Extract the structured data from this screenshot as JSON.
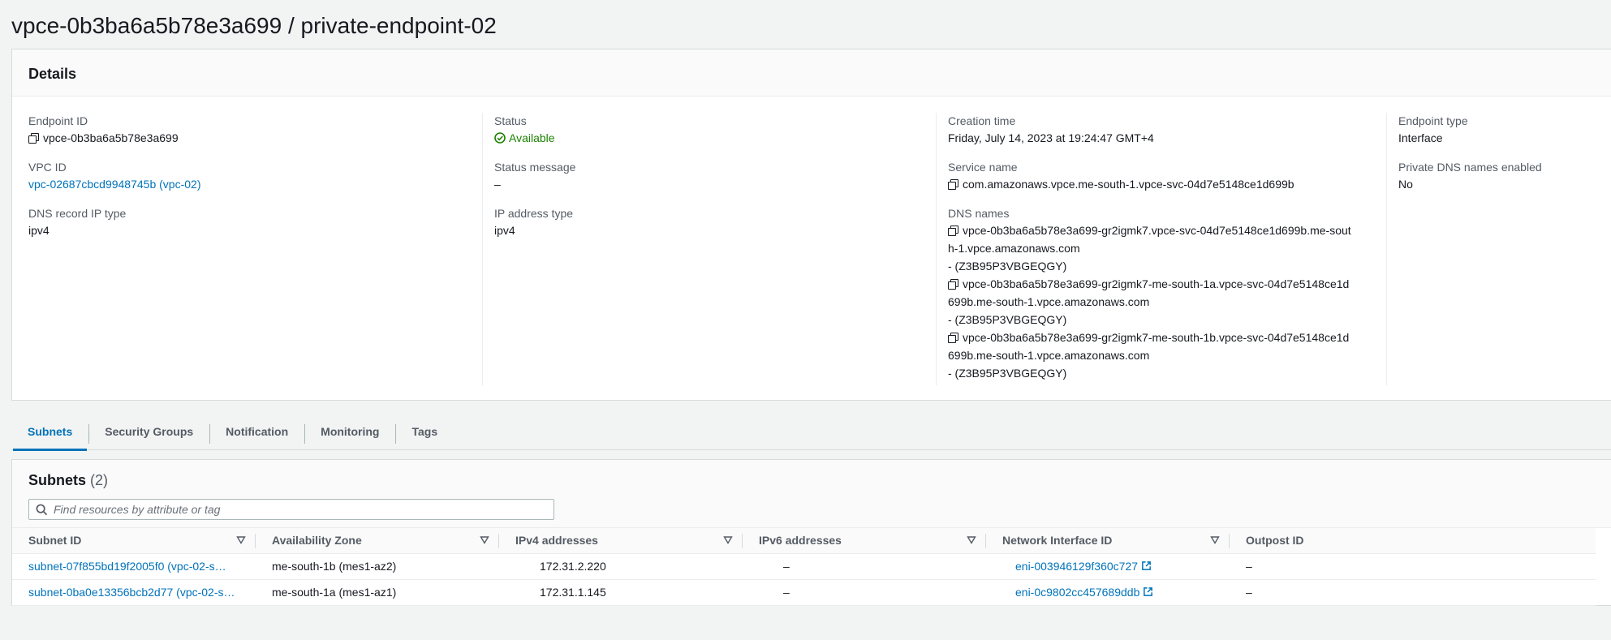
{
  "page": {
    "title": "vpce-0b3ba6a5b78e3a699 / private-endpoint-02"
  },
  "details": {
    "heading": "Details",
    "endpoint_id": {
      "label": "Endpoint ID",
      "value": "vpce-0b3ba6a5b78e3a699"
    },
    "vpc_id": {
      "label": "VPC ID",
      "value": "vpc-02687cbcd9948745b (vpc-02)"
    },
    "dns_record_ip_type": {
      "label": "DNS record IP type",
      "value": "ipv4"
    },
    "status": {
      "label": "Status",
      "value": "Available"
    },
    "status_message": {
      "label": "Status message",
      "value": "–"
    },
    "ip_address_type": {
      "label": "IP address type",
      "value": "ipv4"
    },
    "creation_time": {
      "label": "Creation time",
      "value": "Friday, July 14, 2023 at 19:24:47 GMT+4"
    },
    "service_name": {
      "label": "Service name",
      "value": "com.amazonaws.vpce.me-south-1.vpce-svc-04d7e5148ce1d699b"
    },
    "dns_names": {
      "label": "DNS names",
      "entries": [
        {
          "name": "vpce-0b3ba6a5b78e3a699-gr2igmk7.vpce-svc-04d7e5148ce1d699b.me-south-1.vpce.amazonaws.com",
          "zone": "- (Z3B95P3VBGEQGY)"
        },
        {
          "name": "vpce-0b3ba6a5b78e3a699-gr2igmk7-me-south-1a.vpce-svc-04d7e5148ce1d699b.me-south-1.vpce.amazonaws.com",
          "zone": "- (Z3B95P3VBGEQGY)"
        },
        {
          "name": "vpce-0b3ba6a5b78e3a699-gr2igmk7-me-south-1b.vpce-svc-04d7e5148ce1d699b.me-south-1.vpce.amazonaws.com",
          "zone": "- (Z3B95P3VBGEQGY)"
        }
      ]
    },
    "endpoint_type": {
      "label": "Endpoint type",
      "value": "Interface"
    },
    "private_dns": {
      "label": "Private DNS names enabled",
      "value": "No"
    }
  },
  "tabs": [
    "Subnets",
    "Security Groups",
    "Notification",
    "Monitoring",
    "Tags"
  ],
  "subnets": {
    "heading": "Subnets",
    "count": "(2)",
    "search_placeholder": "Find resources by attribute or tag",
    "columns": [
      "Subnet ID",
      "Availability Zone",
      "IPv4 addresses",
      "IPv6 addresses",
      "Network Interface ID",
      "Outpost ID"
    ],
    "rows": [
      {
        "subnet": "subnet-07f855bd19f2005f0 (vpc-02-s…",
        "az": "me-south-1b (mes1-az2)",
        "ipv4": "172.31.2.220",
        "ipv6": "–",
        "eni": "eni-003946129f360c727",
        "outpost": "–"
      },
      {
        "subnet": "subnet-0ba0e13356bcb2d77 (vpc-02-s…",
        "az": "me-south-1a (mes1-az1)",
        "ipv4": "172.31.1.145",
        "ipv6": "–",
        "eni": "eni-0c9802cc457689ddb",
        "outpost": "–"
      }
    ]
  },
  "colors": {
    "link": "#0073bb",
    "success": "#1d8102",
    "label": "#545b64"
  }
}
